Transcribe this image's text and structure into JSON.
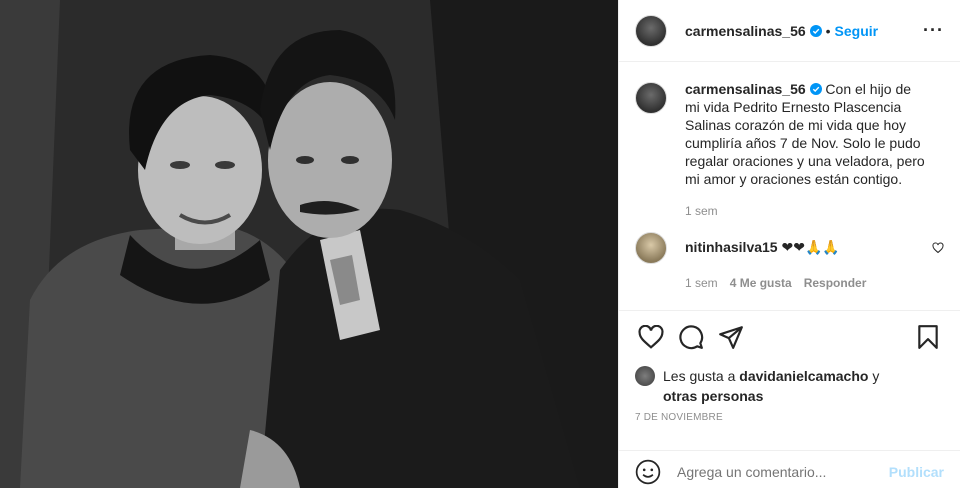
{
  "post": {
    "author": "carmensalinas_56",
    "follow_label": "Seguir",
    "more_label": "···",
    "caption": "Con el hijo de mi vida Pedrito Ernesto Plascencia Salinas corazón de mi vida que hoy cumpliría años 7 de Nov. Solo le pudo regalar oraciones y una veladora, pero mi amor y oraciones están contigo.",
    "caption_ago": "1 sem"
  },
  "comments": [
    {
      "username": "nitinhasilva15",
      "text": "❤❤🙏🙏",
      "ago": "1 sem",
      "likes": "4 Me gusta",
      "reply_label": "Responder"
    }
  ],
  "likes": {
    "prefix": "Les gusta a ",
    "user": "davidanielcamacho",
    "connector": " y",
    "others": "otras personas"
  },
  "date": "7 DE NOVIEMBRE",
  "add_comment": {
    "placeholder": "Agrega un comentario...",
    "publish_label": "Publicar"
  },
  "colors": {
    "accent": "#0095f6",
    "publish_disabled": "#b2dffc",
    "muted": "#8e8e8e",
    "heart": "#ed4956"
  },
  "icons": [
    "heart-icon",
    "comment-icon",
    "share-icon",
    "bookmark-icon",
    "smile-icon",
    "verified-icon"
  ]
}
